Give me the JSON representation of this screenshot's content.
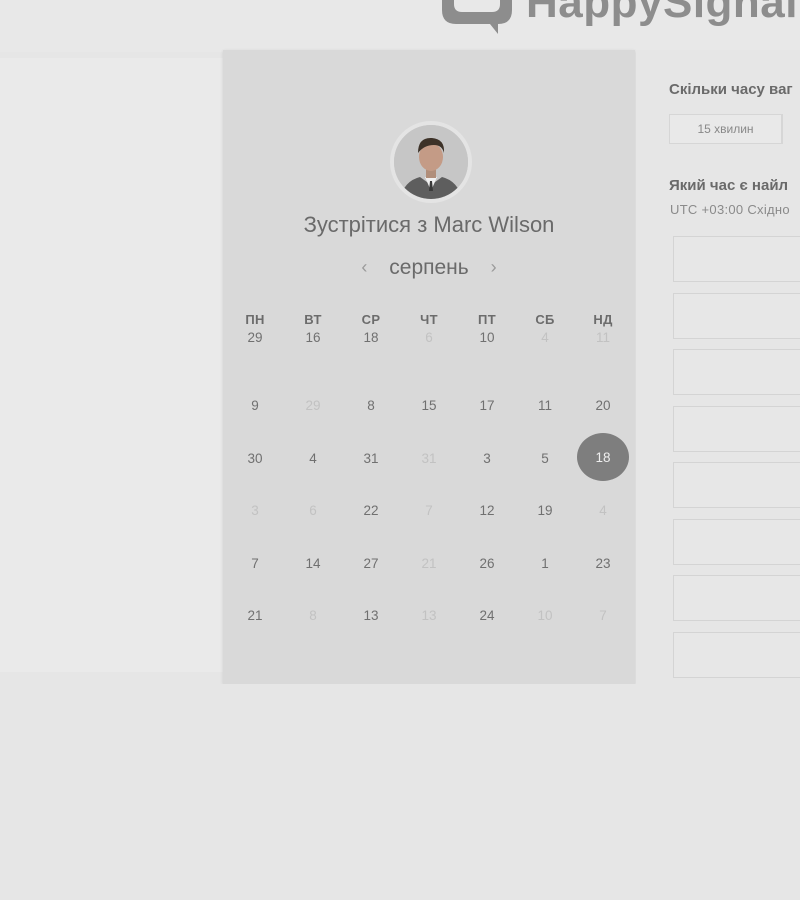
{
  "header": {
    "logo_text": "HappySignal"
  },
  "host": {
    "title_prefix": "Зустрітися з",
    "name": "Marc Wilson"
  },
  "calendar": {
    "month": "серпень",
    "prev_icon": "chevron-left-icon",
    "next_icon": "chevron-right-icon",
    "weekdays": [
      "ПН",
      "ВТ",
      "СР",
      "ЧТ",
      "ПТ",
      "СБ",
      "НД"
    ],
    "weeks": [
      [
        {
          "d": "29"
        },
        {
          "d": "16"
        },
        {
          "d": "18"
        },
        {
          "d": "6",
          "muted": true
        },
        {
          "d": "10"
        },
        {
          "d": "4",
          "muted": true
        },
        {
          "d": "11",
          "muted": true
        }
      ],
      [
        {
          "d": "9"
        },
        {
          "d": "29",
          "muted": true
        },
        {
          "d": "8"
        },
        {
          "d": "15"
        },
        {
          "d": "17"
        },
        {
          "d": "11"
        },
        {
          "d": "20"
        }
      ],
      [
        {
          "d": "30"
        },
        {
          "d": "4"
        },
        {
          "d": "31"
        },
        {
          "d": "31",
          "muted": true
        },
        {
          "d": "3"
        },
        {
          "d": "5"
        },
        {
          "d": "18",
          "selected": true
        }
      ],
      [
        {
          "d": "3",
          "muted": true
        },
        {
          "d": "6",
          "muted": true
        },
        {
          "d": "22"
        },
        {
          "d": "7",
          "muted": true
        },
        {
          "d": "12"
        },
        {
          "d": "19"
        },
        {
          "d": "4",
          "muted": true
        }
      ],
      [
        {
          "d": "7"
        },
        {
          "d": "14"
        },
        {
          "d": "27"
        },
        {
          "d": "21",
          "muted": true
        },
        {
          "d": "26"
        },
        {
          "d": "1"
        },
        {
          "d": "23"
        }
      ],
      [
        {
          "d": "21"
        },
        {
          "d": "8",
          "muted": true
        },
        {
          "d": "13"
        },
        {
          "d": "13",
          "muted": true
        },
        {
          "d": "24"
        },
        {
          "d": "10",
          "muted": true
        },
        {
          "d": "7",
          "muted": true
        }
      ]
    ]
  },
  "booking": {
    "duration_question": "Скільки часу ваг",
    "duration_option": "15 хвилин",
    "time_question": "Який час є найл",
    "timezone": "UTC +03:00 Східно",
    "slot_count": 8
  }
}
